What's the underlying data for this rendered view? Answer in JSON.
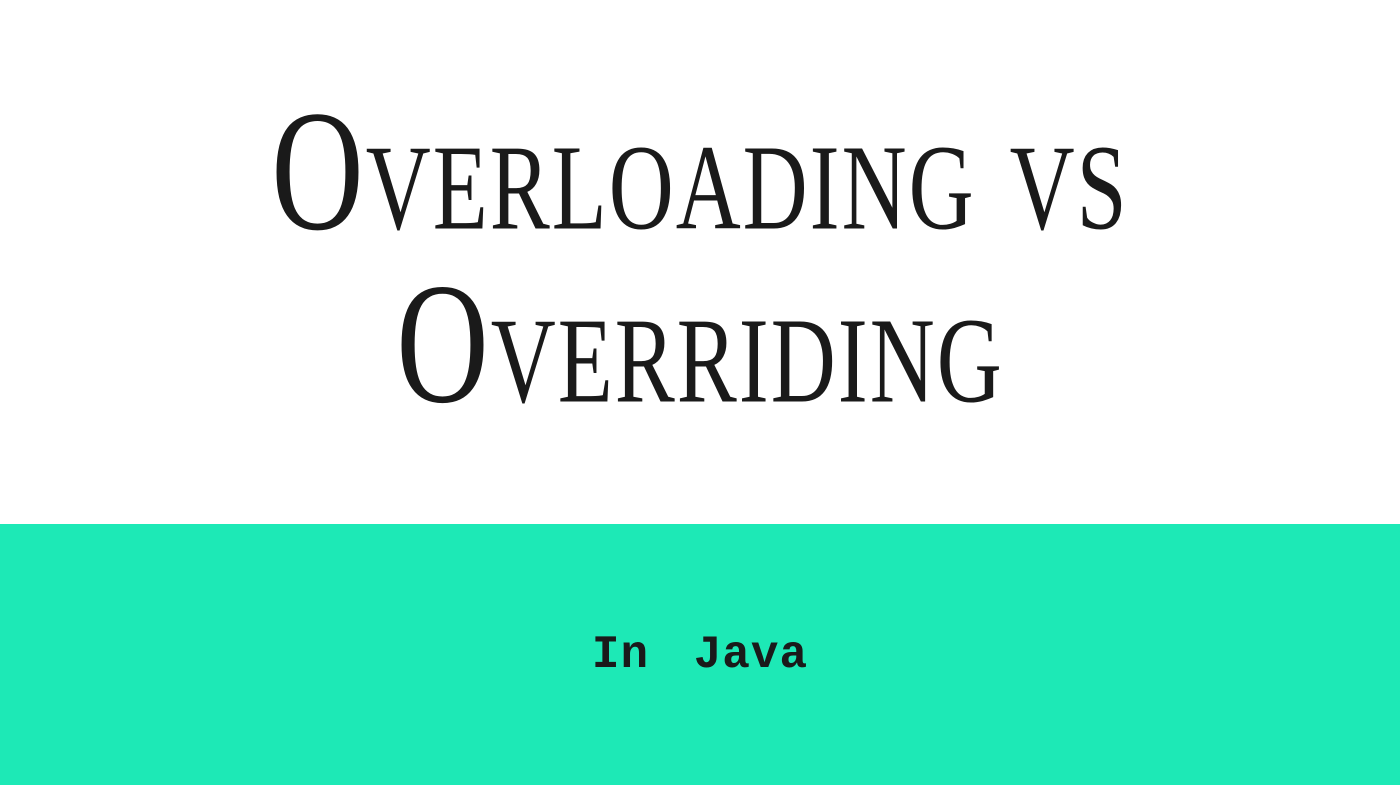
{
  "slide": {
    "title": "Overloading vs Overriding",
    "subtitle": "In Java"
  },
  "colors": {
    "background_top": "#ffffff",
    "background_bottom": "#1de9b6",
    "text": "#1a1a1a"
  }
}
